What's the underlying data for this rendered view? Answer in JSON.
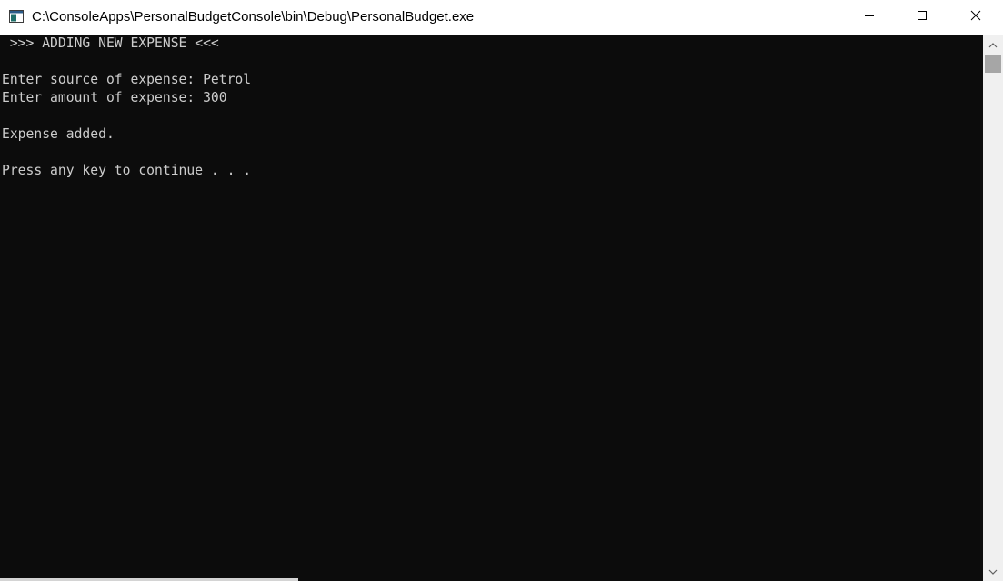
{
  "window": {
    "title": "C:\\ConsoleApps\\PersonalBudgetConsole\\bin\\Debug\\PersonalBudget.exe",
    "icon": "console-window-icon"
  },
  "caption_buttons": {
    "minimize_icon": "minimize-icon",
    "maximize_icon": "maximize-icon",
    "close_icon": "close-icon"
  },
  "console": {
    "lines": [
      " >>> ADDING NEW EXPENSE <<<",
      "",
      "Enter source of expense: Petrol",
      "Enter amount of expense: 300",
      "",
      "Expense added.",
      "",
      "Press any key to continue . . ."
    ],
    "text_color": "#cccccc",
    "background_color": "#0c0c0c"
  },
  "scrollbar": {
    "up_icon": "scroll-up-arrow-icon",
    "down_icon": "scroll-down-arrow-icon"
  }
}
